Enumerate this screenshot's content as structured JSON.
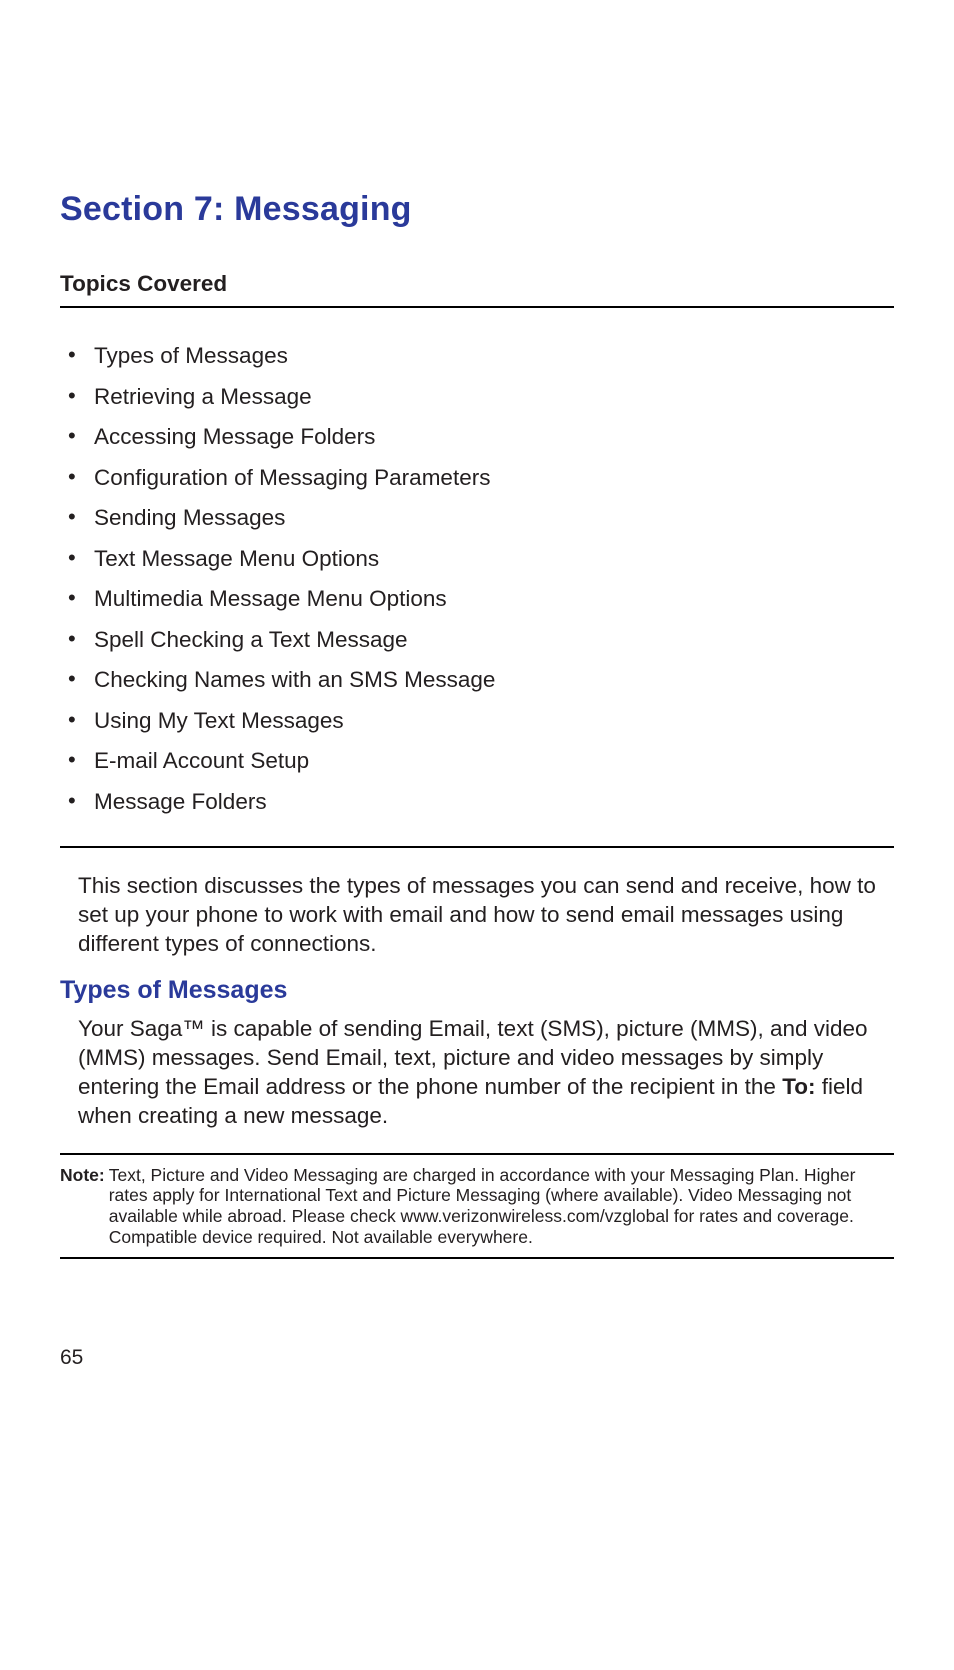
{
  "section_title": "Section 7: Messaging",
  "topics_label": "Topics Covered",
  "topics": [
    "Types of Messages",
    "Retrieving a Message",
    "Accessing Message Folders",
    "Configuration of Messaging Parameters",
    "Sending Messages",
    "Text Message Menu Options",
    "Multimedia Message Menu Options",
    "Spell Checking a Text Message",
    "Checking Names with an SMS Message",
    "Using My Text Messages",
    "E-mail Account Setup",
    "Message Folders"
  ],
  "intro_paragraph": "This section discusses the types of messages you can send and receive, how to set up your phone to work with email and how to send email messages using different types of connections.",
  "subheading": "Types of Messages",
  "types_paragraph_pre": "Your Saga™ is capable of sending Email, text (SMS), picture (MMS), and video (MMS) messages. Send Email, text, picture and video messages by simply entering the Email address or the phone number of the recipient in the ",
  "types_paragraph_bold": "To:",
  "types_paragraph_post": " field when creating a new message.",
  "note_label": "Note:",
  "note_text": "Text, Picture and Video Messaging are charged in accordance with your Messaging Plan. Higher rates apply for International Text and Picture Messaging (where available). Video Messaging not available while abroad. Please check www.verizonwireless.com/vzglobal for rates and coverage. Compatible device required. Not available everywhere.",
  "page_number": "65"
}
